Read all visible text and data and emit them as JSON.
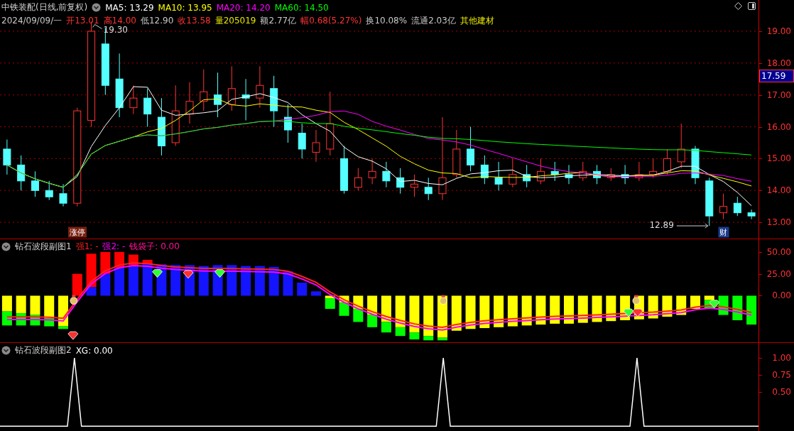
{
  "title": "中铁装配(日线,前复权)",
  "ma": [
    {
      "label": "MA5: 13.29",
      "color": "#ffffff"
    },
    {
      "label": "MA10: 13.95",
      "color": "#ffff00"
    },
    {
      "label": "MA20: 14.20",
      "color": "#ff00ff"
    },
    {
      "label": "MA60: 14.50",
      "color": "#00ff00"
    }
  ],
  "quote": [
    {
      "text": "2024/09/09/一",
      "color": "#c8c8c8"
    },
    {
      "text": "开13.01",
      "color": "#ff3232"
    },
    {
      "text": "高14.00",
      "color": "#ff3232"
    },
    {
      "text": "低12.90",
      "color": "#c8c8c8"
    },
    {
      "text": "收13.58",
      "color": "#ff3232"
    },
    {
      "text": "量205019",
      "color": "#e6e600"
    },
    {
      "text": "额2.77亿",
      "color": "#c8c8c8"
    },
    {
      "text": "幅0.68(5.27%)",
      "color": "#ff3232"
    },
    {
      "text": "换10.08%",
      "color": "#c8c8c8"
    },
    {
      "text": "流通2.03亿",
      "color": "#c8c8c8"
    },
    {
      "text": "其他建材",
      "color": "#e6e600"
    }
  ],
  "main_chart": {
    "axis_labels": [
      "19.00",
      "18.00",
      "17.00",
      "16.00",
      "15.00",
      "14.00",
      "13.00"
    ],
    "price_tag": "17.59",
    "high_label": "19.30",
    "low_label": "12.89",
    "badges": [
      {
        "text": "涨停",
        "color": "#7a2010"
      },
      {
        "text": "财",
        "color": "#1a3a8a"
      }
    ]
  },
  "sub_chart_1": {
    "title": "钻石波段副图1",
    "legend": [
      {
        "text": "强1: -",
        "color": "#ff2020"
      },
      {
        "text": "强2: -",
        "color": "#ff00ff"
      },
      {
        "text": "钱袋子: 0.00",
        "color": "#ff1493"
      }
    ],
    "axis_labels": [
      "50.00",
      "25.00",
      "0.00"
    ]
  },
  "sub_chart_2": {
    "title": "钻石波段副图2",
    "legend": [
      {
        "text": "XG: 0.00",
        "color": "#ffffff"
      }
    ],
    "axis_labels": [
      "1.00",
      "0.75",
      "0.50"
    ]
  }
}
